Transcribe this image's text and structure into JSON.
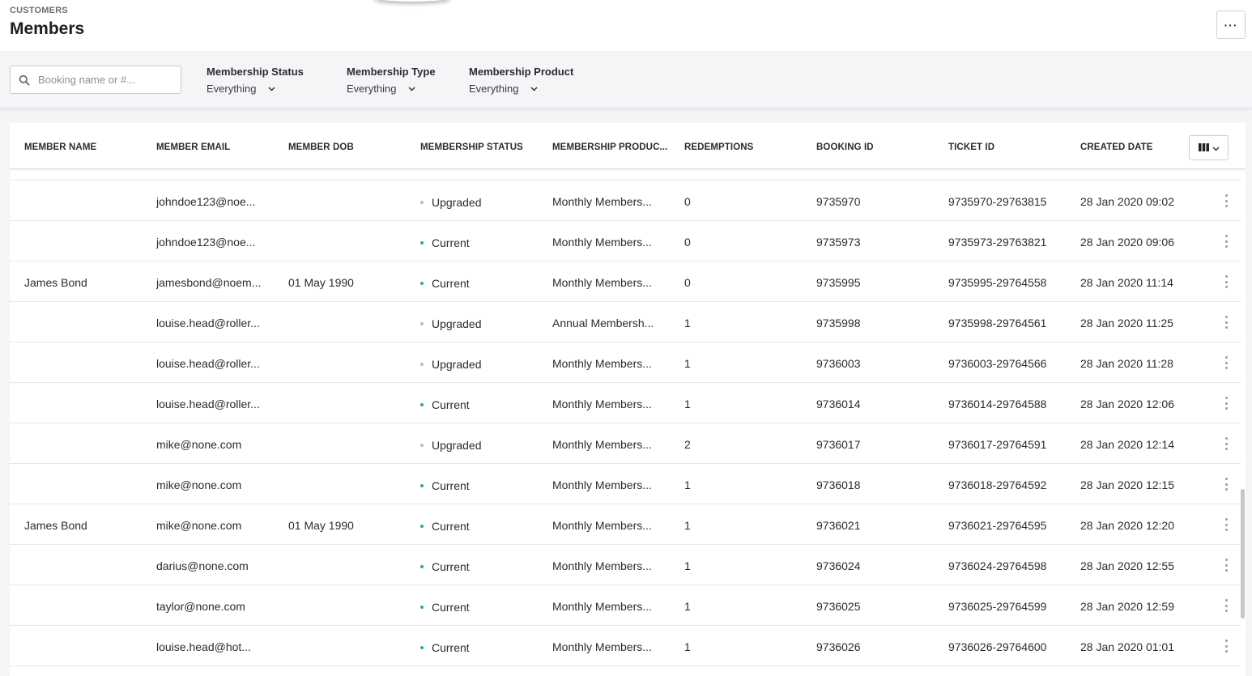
{
  "header": {
    "breadcrumb": "CUSTOMERS",
    "title": "Members",
    "more_label": "···"
  },
  "filters": {
    "search_placeholder": "Booking name or #...",
    "search_value": "",
    "status": {
      "label": "Membership Status",
      "value": "Everything"
    },
    "type": {
      "label": "Membership Type",
      "value": "Everything"
    },
    "product": {
      "label": "Membership Product",
      "value": "Everything"
    }
  },
  "table": {
    "columns": [
      "MEMBER NAME",
      "MEMBER EMAIL",
      "MEMBER DOB",
      "MEMBERSHIP STATUS",
      "MEMBERSHIP PRODUC...",
      "REDEMPTIONS",
      "BOOKING ID",
      "TICKET ID",
      "CREATED DATE"
    ],
    "rows": [
      {
        "name": "",
        "email": "johndoe123@noe...",
        "dob": "",
        "status": "Upgraded",
        "product": "Monthly Members...",
        "redemptions": "0",
        "booking_id": "9735970",
        "ticket_id": "9735970-29763815",
        "created": "28 Jan 2020 09:02"
      },
      {
        "name": "",
        "email": "johndoe123@noe...",
        "dob": "",
        "status": "Current",
        "product": "Monthly Members...",
        "redemptions": "0",
        "booking_id": "9735973",
        "ticket_id": "9735973-29763821",
        "created": "28 Jan 2020 09:06"
      },
      {
        "name": "James Bond",
        "email": "jamesbond@noem...",
        "dob": "01 May 1990",
        "status": "Current",
        "product": "Monthly Members...",
        "redemptions": "0",
        "booking_id": "9735995",
        "ticket_id": "9735995-29764558",
        "created": "28 Jan 2020 11:14"
      },
      {
        "name": "",
        "email": "louise.head@roller...",
        "dob": "",
        "status": "Upgraded",
        "product": "Annual Membersh...",
        "redemptions": "1",
        "booking_id": "9735998",
        "ticket_id": "9735998-29764561",
        "created": "28 Jan 2020 11:25"
      },
      {
        "name": "",
        "email": "louise.head@roller...",
        "dob": "",
        "status": "Upgraded",
        "product": "Monthly Members...",
        "redemptions": "1",
        "booking_id": "9736003",
        "ticket_id": "9736003-29764566",
        "created": "28 Jan 2020 11:28"
      },
      {
        "name": "",
        "email": "louise.head@roller...",
        "dob": "",
        "status": "Current",
        "product": "Monthly Members...",
        "redemptions": "1",
        "booking_id": "9736014",
        "ticket_id": "9736014-29764588",
        "created": "28 Jan 2020 12:06"
      },
      {
        "name": "",
        "email": "mike@none.com",
        "dob": "",
        "status": "Upgraded",
        "product": "Monthly Members...",
        "redemptions": "2",
        "booking_id": "9736017",
        "ticket_id": "9736017-29764591",
        "created": "28 Jan 2020 12:14"
      },
      {
        "name": "",
        "email": "mike@none.com",
        "dob": "",
        "status": "Current",
        "product": "Monthly Members...",
        "redemptions": "1",
        "booking_id": "9736018",
        "ticket_id": "9736018-29764592",
        "created": "28 Jan 2020 12:15"
      },
      {
        "name": "James Bond",
        "email": "mike@none.com",
        "dob": "01 May 1990",
        "status": "Current",
        "product": "Monthly Members...",
        "redemptions": "1",
        "booking_id": "9736021",
        "ticket_id": "9736021-29764595",
        "created": "28 Jan 2020 12:20"
      },
      {
        "name": "",
        "email": "darius@none.com",
        "dob": "",
        "status": "Current",
        "product": "Monthly Members...",
        "redemptions": "1",
        "booking_id": "9736024",
        "ticket_id": "9736024-29764598",
        "created": "28 Jan 2020 12:55"
      },
      {
        "name": "",
        "email": "taylor@none.com",
        "dob": "",
        "status": "Current",
        "product": "Monthly Members...",
        "redemptions": "1",
        "booking_id": "9736025",
        "ticket_id": "9736025-29764599",
        "created": "28 Jan 2020 12:59"
      },
      {
        "name": "",
        "email": "louise.head@hot...",
        "dob": "",
        "status": "Current",
        "product": "Monthly Members...",
        "redemptions": "1",
        "booking_id": "9736026",
        "ticket_id": "9736026-29764600",
        "created": "28 Jan 2020 01:01"
      }
    ]
  },
  "colors": {
    "current": "#27b36b",
    "upgraded": "#b8bbbf"
  },
  "icons": {
    "search": "search-icon",
    "chevron": "chevron-down-icon",
    "columns": "columns-icon",
    "kebab": "kebab-menu-icon"
  }
}
